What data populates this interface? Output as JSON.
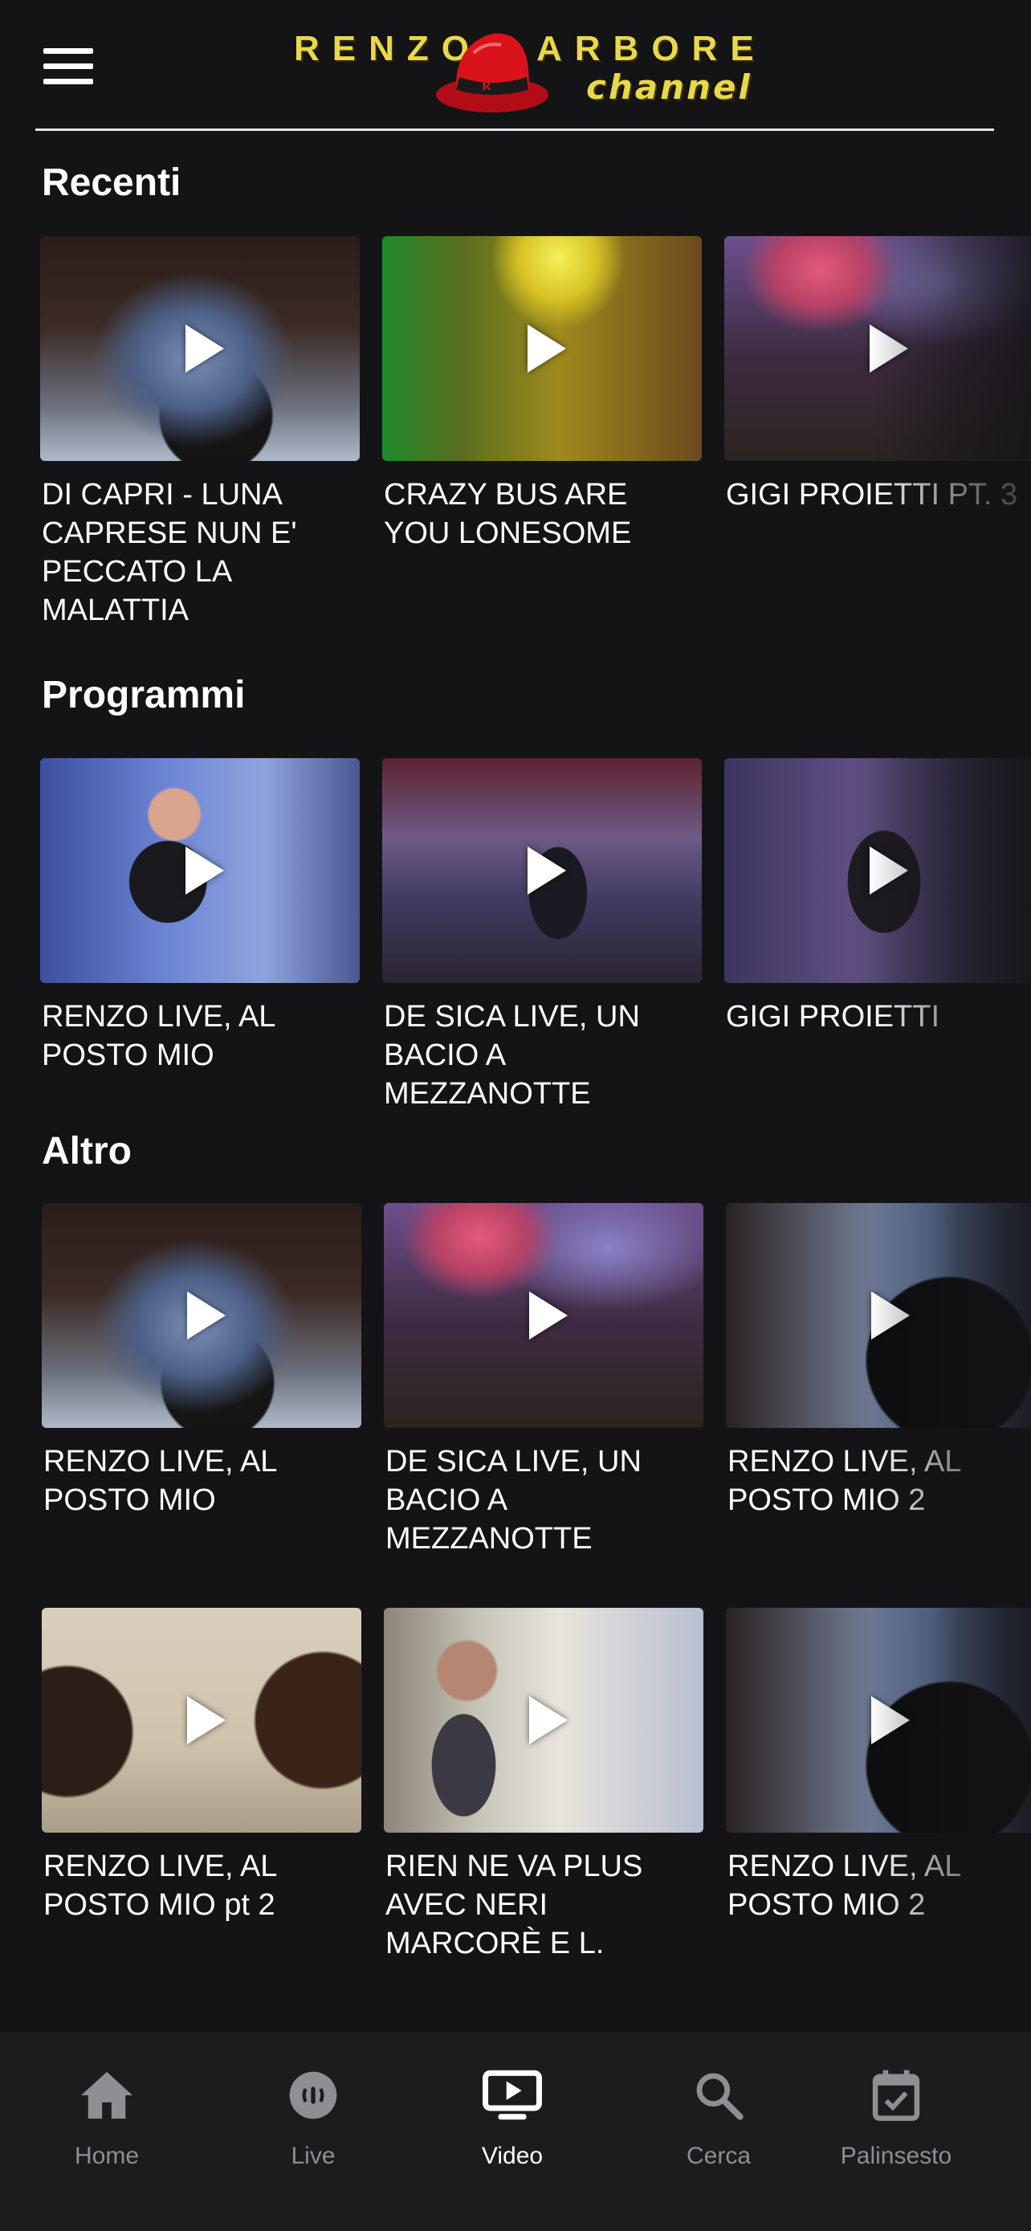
{
  "header": {
    "menu_label": "",
    "logo_left": "RENZO",
    "logo_right": "ARBORE",
    "logo_channel": "channel"
  },
  "sections": {
    "recenti": {
      "title": "Recenti",
      "items": [
        {
          "title": "DI CAPRI - LUNA CAPRESE NUN E' PECCATO LA MALATTIA"
        },
        {
          "title": "CRAZY BUS ARE YOU LONESOME"
        },
        {
          "title": "GIGI PROIETTI PT. 3"
        }
      ]
    },
    "programmi": {
      "title": "Programmi",
      "items": [
        {
          "title": "RENZO LIVE, AL POSTO MIO"
        },
        {
          "title": "DE SICA LIVE, UN BACIO A MEZZANOTTE"
        },
        {
          "title": "GIGI PROIETTI"
        }
      ]
    },
    "altro": {
      "title": "Altro",
      "items": [
        {
          "title": "RENZO LIVE, AL POSTO MIO"
        },
        {
          "title": "DE SICA LIVE, UN BACIO A MEZZANOTTE"
        },
        {
          "title": "RENZO LIVE, AL POSTO MIO 2"
        },
        {
          "title": "RENZO LIVE, AL POSTO MIO pt 2"
        },
        {
          "title": "RIEN NE VA PLUS AVEC NERI MARCORÈ E L."
        },
        {
          "title": "RENZO LIVE, AL POSTO MIO 2"
        }
      ]
    }
  },
  "nav": {
    "items": [
      {
        "label": "Home",
        "icon": "home-icon"
      },
      {
        "label": "Live",
        "icon": "live-icon"
      },
      {
        "label": "Video",
        "icon": "video-icon"
      },
      {
        "label": "Cerca",
        "icon": "search-icon"
      },
      {
        "label": "Palinsesto",
        "icon": "calendar-icon"
      }
    ],
    "active": "Video"
  },
  "colors": {
    "background": "#141416",
    "nav_background": "#1c1c1e",
    "logo_yellow": "#e8d84a",
    "hat_red": "#d8131c",
    "inactive": "#8e8e93"
  }
}
